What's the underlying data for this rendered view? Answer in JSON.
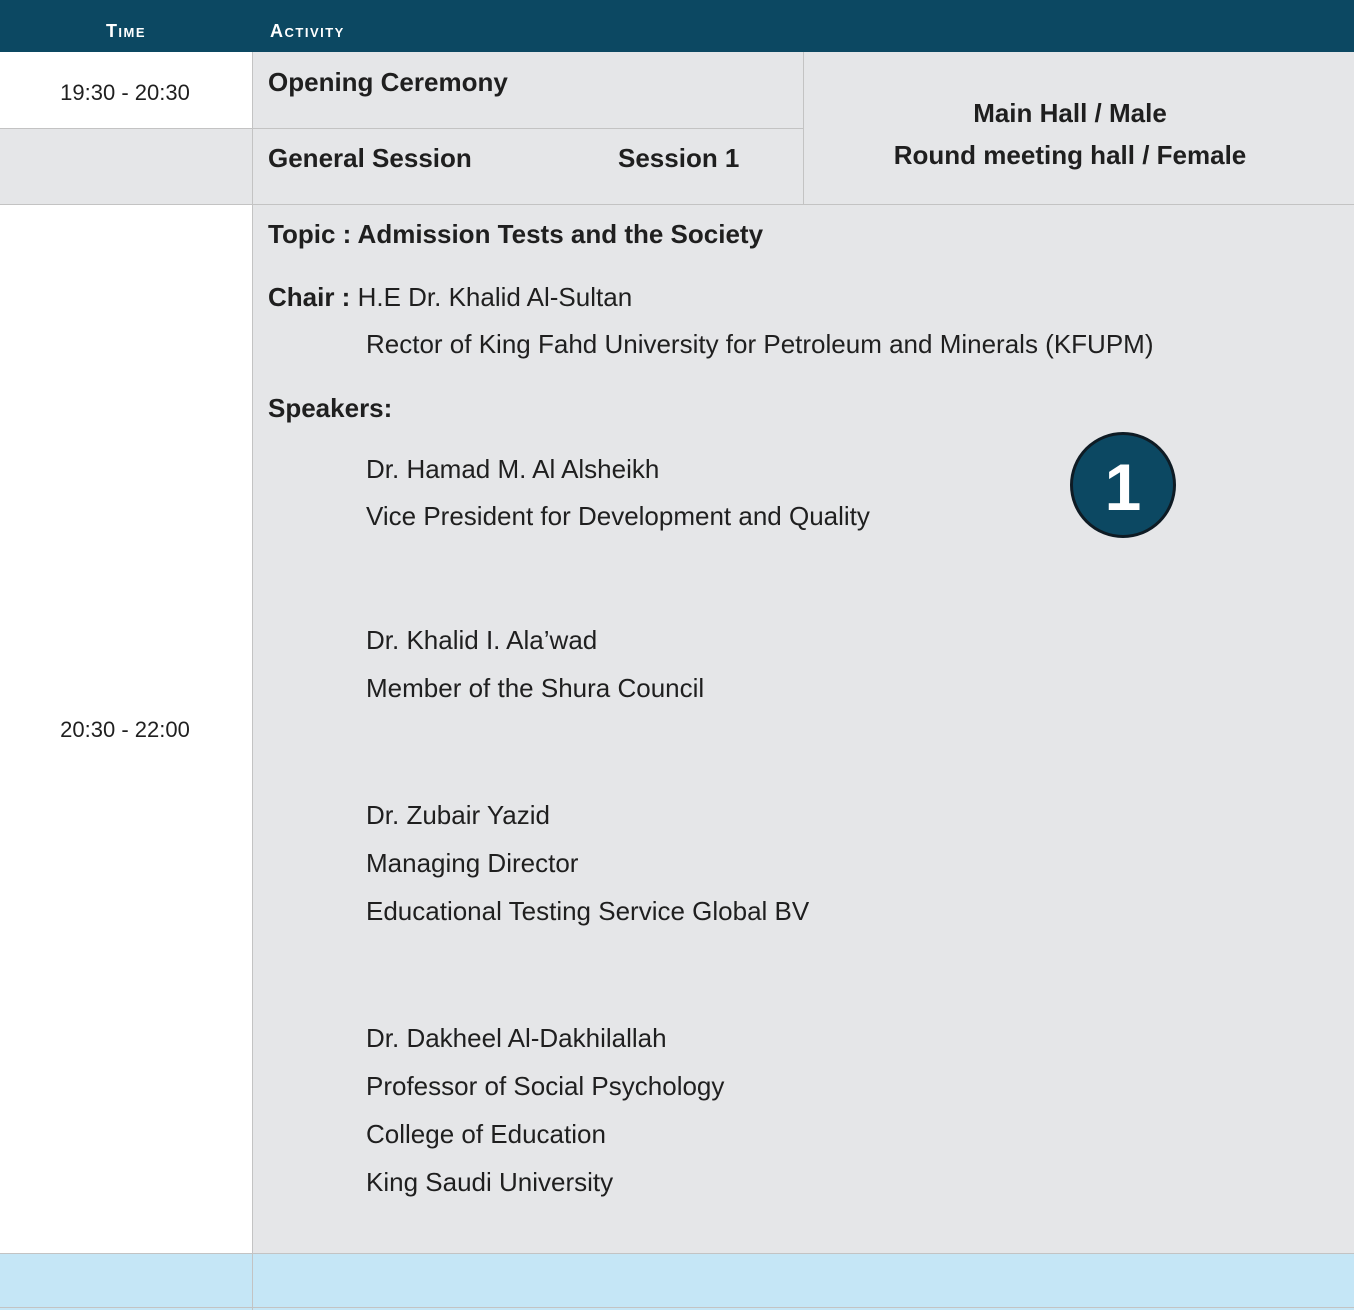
{
  "colors": {
    "header_bg": "#0c4862",
    "row_bg": "#e5e6e8",
    "footer_bg": "#c5e6f6",
    "badge_bg": "#0c4862"
  },
  "header": {
    "time_label": "Time",
    "activity_label": "Activity"
  },
  "rows": {
    "opening": {
      "time": "19:30 - 20:30",
      "activity": "Opening Ceremony"
    },
    "general": {
      "activity": "General Session",
      "session": "Session 1"
    },
    "location": {
      "line1": "Main Hall / Male",
      "line2": "Round meeting hall / Female"
    },
    "session1": {
      "time": "20:30 -  22:00",
      "topic": "Topic : Admission Tests and the Society",
      "chair_label": "Chair : ",
      "chair_name": "H.E Dr. Khalid Al-Sultan",
      "chair_title": "Rector of King Fahd University for Petroleum and Minerals (KFUPM)",
      "speakers_label": "Speakers:",
      "badge": "1",
      "speakers": [
        {
          "lines": [
            "Dr. Hamad M. Al Alsheikh",
            "Vice President for Development and Quality"
          ]
        },
        {
          "lines": [
            "Dr. Khalid I. Ala’wad",
            "Member of the Shura Council"
          ]
        },
        {
          "lines": [
            "Dr. Zubair Yazid",
            "Managing Director",
            "Educational Testing Service Global BV"
          ]
        },
        {
          "lines": [
            "Dr. Dakheel Al-Dakhilallah",
            "Professor of Social Psychology",
            "College of Education",
            "King Saudi University"
          ]
        }
      ]
    }
  }
}
